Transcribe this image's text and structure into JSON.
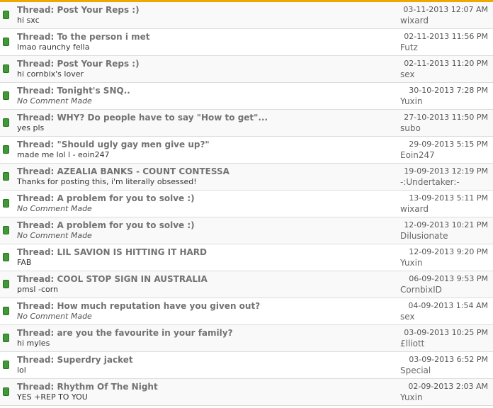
{
  "reputation": {
    "rows": [
      {
        "thread": "Thread: Post Your Reps :)",
        "comment": "hi sxc",
        "muted": false,
        "date": "03-11-2013 12:07 AM",
        "user": "wixard"
      },
      {
        "thread": "Thread: To the person i met",
        "comment": "lmao raunchy fella",
        "muted": false,
        "date": "02-11-2013 11:56 PM",
        "user": "Futz"
      },
      {
        "thread": "Thread: Post Your Reps :)",
        "comment": "hi cornbix's lover",
        "muted": false,
        "date": "02-11-2013 11:20 PM",
        "user": "sex"
      },
      {
        "thread": "Thread: Tonight's SNQ..",
        "comment": "No Comment Made",
        "muted": true,
        "date": "30-10-2013 7:28 PM",
        "user": "Yuxin"
      },
      {
        "thread": "Thread: WHY? Do people have to say \"How to get\"...",
        "comment": "yes pls",
        "muted": false,
        "date": "27-10-2013 11:50 PM",
        "user": "subo"
      },
      {
        "thread": "Thread: \"Should ugly gay men give up?\"",
        "comment": "made me lol l - eoin247",
        "muted": false,
        "date": "29-09-2013 5:15 PM",
        "user": "Eoin247"
      },
      {
        "thread": "Thread: AZEALIA BANKS - COUNT CONTESSA",
        "comment": "Thanks for posting this, i'm literally obsessed!",
        "muted": false,
        "date": "19-09-2013 12:19 PM",
        "user": "-:Undertaker:-"
      },
      {
        "thread": "Thread: A problem for you to solve :)",
        "comment": "No Comment Made",
        "muted": true,
        "date": "13-09-2013 5:11 PM",
        "user": "wixard"
      },
      {
        "thread": "Thread: A problem for you to solve :)",
        "comment": "No Comment Made",
        "muted": true,
        "date": "12-09-2013 10:21 PM",
        "user": "Dilusionate"
      },
      {
        "thread": "Thread: LIL SAVION IS HITTING IT HARD",
        "comment": "FAB",
        "muted": false,
        "date": "12-09-2013 9:20 PM",
        "user": "Yuxin"
      },
      {
        "thread": "Thread: COOL STOP SIGN IN AUSTRALIA",
        "comment": "pmsl -corn",
        "muted": false,
        "date": "06-09-2013 9:53 PM",
        "user": "CornbixID"
      },
      {
        "thread": "Thread: How much reputation have you given out?",
        "comment": "No Comment Made",
        "muted": true,
        "date": "04-09-2013 1:54 AM",
        "user": "sex"
      },
      {
        "thread": "Thread: are you the favourite in your family?",
        "comment": "hi myles",
        "muted": false,
        "date": "03-09-2013 10:25 PM",
        "user": "£lliott"
      },
      {
        "thread": "Thread: Superdry jacket",
        "comment": "lol",
        "muted": false,
        "date": "03-09-2013 6:52 PM",
        "user": "Special"
      },
      {
        "thread": "Thread: Rhythm Of The Night",
        "comment": "YES +REP TO YOU",
        "muted": false,
        "date": "02-09-2013 2:03 AM",
        "user": "Yuxin"
      }
    ]
  },
  "colors": {
    "accent_bar": "#f0a800",
    "bullet": "#3f9a36"
  },
  "icons": {
    "bullet": "green-reputation-icon"
  }
}
